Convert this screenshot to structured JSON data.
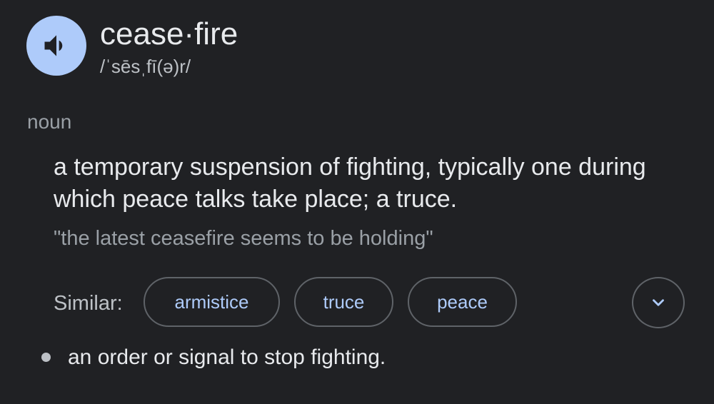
{
  "entry": {
    "headword": "cease·fire",
    "phonetic": "/ˈsēsˌfī(ə)r/",
    "audio_icon": "speaker-icon"
  },
  "sense_group": {
    "part_of_speech": "noun",
    "definition": "a temporary suspension of fighting, typically one during which peace talks take place; a truce.",
    "example": "\"the latest ceasefire seems to be holding\"",
    "similar_label": "Similar:",
    "similar": [
      {
        "label": "armistice"
      },
      {
        "label": "truce"
      },
      {
        "label": "peace"
      }
    ],
    "expand_icon": "chevron-down-icon"
  },
  "senses": [
    {
      "definition": "an order or signal to stop fighting."
    }
  ],
  "colors": {
    "background": "#202124",
    "speaker_button": "#aecbfa",
    "chip_text": "#aecbfa",
    "chip_border": "#5f6368"
  }
}
